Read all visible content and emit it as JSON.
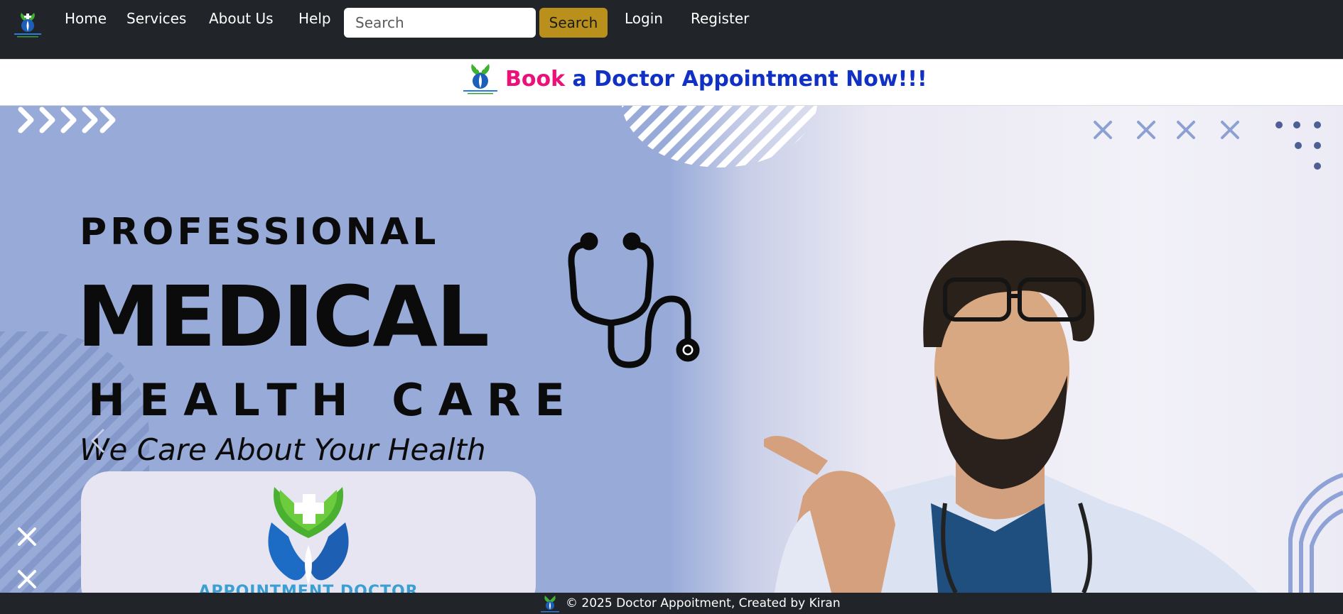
{
  "nav": {
    "links": [
      "Home",
      "Services",
      "About Us",
      "Help"
    ],
    "search_placeholder": "Search",
    "search_button": "Search",
    "login": "Login",
    "register": "Register"
  },
  "banner": {
    "accent_word": "Book",
    "rest_text": " a Doctor Appointment Now!!!",
    "accent_color": "#ec1178",
    "text_color": "#1131c4"
  },
  "hero": {
    "line1": "PROFESSIONAL",
    "line2": "MEDICAL",
    "line3": "HEALTH CARE",
    "tagline": "We Care About Your Health",
    "logo_caption": "APPOINTMENT DOCTOR",
    "background_color": "#97aad8"
  },
  "footer": {
    "text": "© 2025 Doctor Appoitment, Created by Kiran"
  },
  "icons": [
    "logo-icon",
    "stethoscope-icon",
    "chevron-left-icon",
    "close-icon",
    "doctor-photo"
  ]
}
